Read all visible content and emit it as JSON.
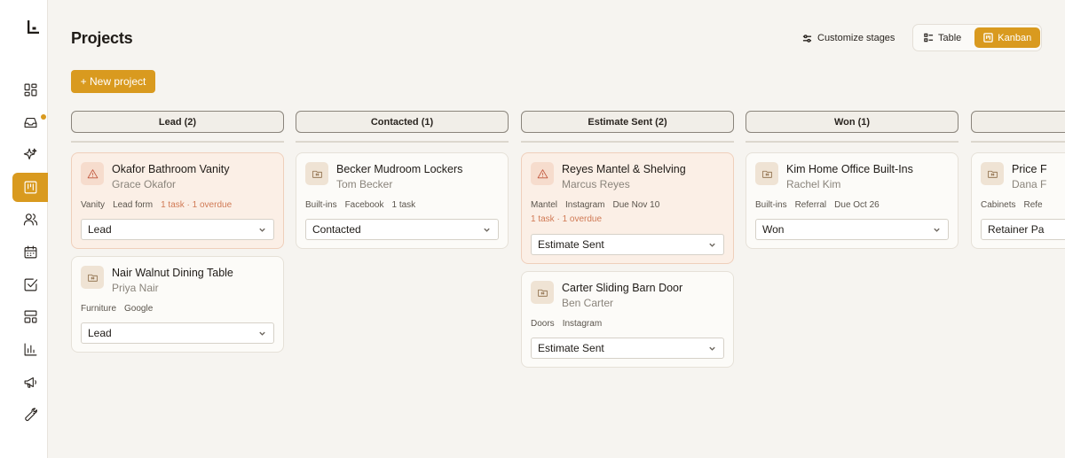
{
  "sidebar": {
    "items": [
      {
        "icon": "dashboard-icon",
        "active": false
      },
      {
        "icon": "inbox-icon",
        "active": false,
        "badge": true
      },
      {
        "icon": "sparkle-icon",
        "active": false
      },
      {
        "icon": "kanban-icon",
        "active": true
      },
      {
        "icon": "users-icon",
        "active": false
      },
      {
        "icon": "calendar-icon",
        "active": false
      },
      {
        "icon": "checkbox-icon",
        "active": false
      },
      {
        "icon": "layout-icon",
        "active": false
      },
      {
        "icon": "bar-chart-icon",
        "active": false
      },
      {
        "icon": "megaphone-icon",
        "active": false
      },
      {
        "icon": "wrench-icon",
        "active": false
      }
    ]
  },
  "header": {
    "title": "Projects",
    "customize_label": "Customize stages",
    "view_table_label": "Table",
    "view_kanban_label": "Kanban",
    "new_project_label": "+ New project"
  },
  "colors": {
    "accent": "#d99a1f",
    "overdue": "#d07a55",
    "alert_bg": "#fbefe6"
  },
  "columns": [
    {
      "header": "Lead (2)",
      "cards": [
        {
          "title": "Okafor Bathroom Vanity",
          "client": "Grace Okafor",
          "alert": true,
          "meta": [
            "Vanity",
            "Lead form"
          ],
          "tasks": "1 task · 1 overdue",
          "stage": "Lead"
        },
        {
          "title": "Nair Walnut Dining Table",
          "client": "Priya Nair",
          "alert": false,
          "meta": [
            "Furniture",
            "Google"
          ],
          "tasks": "",
          "stage": "Lead"
        }
      ]
    },
    {
      "header": "Contacted (1)",
      "cards": [
        {
          "title": "Becker Mudroom Lockers",
          "client": "Tom Becker",
          "alert": false,
          "meta": [
            "Built-ins",
            "Facebook",
            "1 task"
          ],
          "tasks": "",
          "stage": "Contacted"
        }
      ]
    },
    {
      "header": "Estimate Sent (2)",
      "cards": [
        {
          "title": "Reyes Mantel & Shelving",
          "client": "Marcus Reyes",
          "alert": true,
          "meta": [
            "Mantel",
            "Instagram",
            "Due Nov 10"
          ],
          "tasks": "1 task · 1 overdue",
          "stage": "Estimate Sent"
        },
        {
          "title": "Carter Sliding Barn Door",
          "client": "Ben Carter",
          "alert": false,
          "meta": [
            "Doors",
            "Instagram"
          ],
          "tasks": "",
          "stage": "Estimate Sent"
        }
      ]
    },
    {
      "header": "Won (1)",
      "cards": [
        {
          "title": "Kim Home Office Built-Ins",
          "client": "Rachel Kim",
          "alert": false,
          "meta": [
            "Built-ins",
            "Referral",
            "Due Oct 26"
          ],
          "tasks": "",
          "stage": "Won"
        }
      ]
    },
    {
      "header": "",
      "cards": [
        {
          "title": "Price F",
          "client": "Dana F",
          "alert": false,
          "meta": [
            "Cabinets",
            "Refe"
          ],
          "tasks": "",
          "stage": "Retainer Pa"
        }
      ]
    }
  ]
}
